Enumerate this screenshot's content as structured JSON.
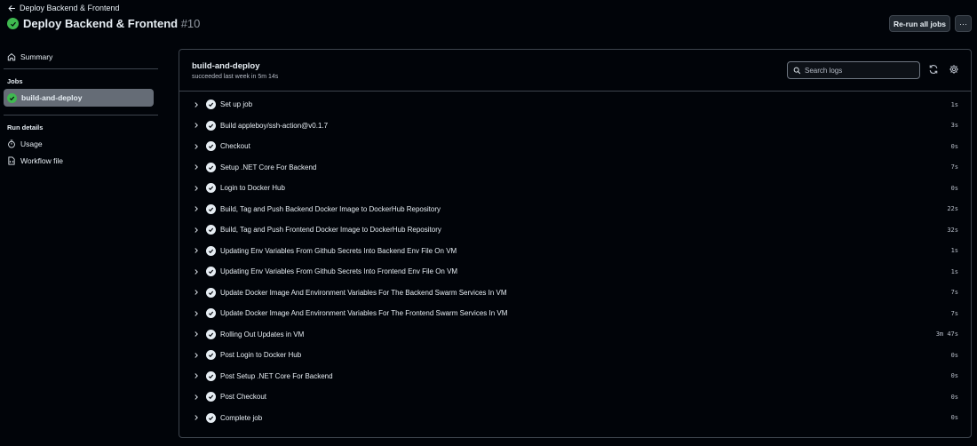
{
  "header": {
    "back_label": "Deploy Backend & Frontend",
    "title": "Deploy Backend & Frontend",
    "run_number": "#10",
    "rerun_label": "Re-run all jobs",
    "more_label": "···"
  },
  "sidebar": {
    "summary_label": "Summary",
    "jobs_heading": "Jobs",
    "job_label": "build-and-deploy",
    "run_details_heading": "Run details",
    "usage_label": "Usage",
    "workflow_file_label": "Workflow file"
  },
  "job": {
    "title": "build-and-deploy",
    "subtitle": "succeeded last week in 5m 14s",
    "search_placeholder": "Search logs"
  },
  "steps": [
    {
      "name": "Set up job",
      "duration": "1s"
    },
    {
      "name": "Build appleboy/ssh-action@v0.1.7",
      "duration": "3s"
    },
    {
      "name": "Checkout",
      "duration": "0s"
    },
    {
      "name": "Setup .NET Core For Backend",
      "duration": "7s"
    },
    {
      "name": "Login to Docker Hub",
      "duration": "0s"
    },
    {
      "name": "Build, Tag and Push Backend Docker Image to DockerHub Repository",
      "duration": "22s"
    },
    {
      "name": "Build, Tag and Push Frontend Docker Image to DockerHub Repository",
      "duration": "32s"
    },
    {
      "name": "Updating Env Variables From Github Secrets Into Backend Env File On VM",
      "duration": "1s"
    },
    {
      "name": "Updating Env Variables From Github Secrets Into Frontend Env File On VM",
      "duration": "1s"
    },
    {
      "name": "Update Docker Image And Environment Variables For The Backend Swarm Services In VM",
      "duration": "7s"
    },
    {
      "name": "Update Docker Image And Environment Variables For The Frontend Swarm Services In VM",
      "duration": "7s"
    },
    {
      "name": "Rolling Out Updates in VM",
      "duration": "3m 47s"
    },
    {
      "name": "Post Login to Docker Hub",
      "duration": "0s"
    },
    {
      "name": "Post Setup .NET Core For Backend",
      "duration": "0s"
    },
    {
      "name": "Post Checkout",
      "duration": "0s"
    },
    {
      "name": "Complete job",
      "duration": "0s"
    }
  ],
  "colors": {
    "background": "#010409",
    "success": "#3fb950",
    "border": "#3d444d",
    "selected": "#656c76"
  },
  "icons": {
    "back": "arrow-left-icon",
    "status": "check-circle-fill-icon",
    "summary": "home-icon",
    "usage": "stopwatch-icon",
    "workflow": "file-code-icon",
    "search": "search-icon",
    "refresh": "sync-icon",
    "settings": "gear-icon",
    "expand": "chevron-right-icon"
  }
}
